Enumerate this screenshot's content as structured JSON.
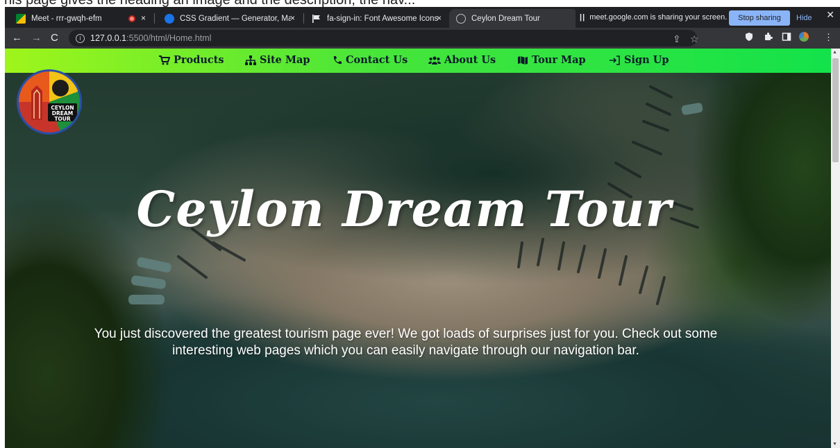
{
  "top_strip_text": "his page gives the heading an image and the description, the nav...",
  "browser": {
    "tabs": [
      {
        "label": "Meet - rrr-gwqh-efm",
        "close": "×"
      },
      {
        "label": "CSS Gradient — Generator, Maker",
        "close": "×"
      },
      {
        "label": "fa-sign-in: Font Awesome Icons",
        "close": "×"
      },
      {
        "label": "Ceylon Dream Tour",
        "close": ""
      }
    ],
    "screen_share": {
      "text": "meet.google.com is sharing your screen.",
      "stop_label": "Stop sharing",
      "hide_label": "Hide"
    },
    "url_host": "127.0.0.1",
    "url_path": ":5500/html/Home.html",
    "window_close": "✕"
  },
  "icons": {
    "products": "cart-icon",
    "site_map": "sitemap-icon",
    "contact": "phone-icon",
    "about": "people-icon",
    "tour_map": "map-icon",
    "sign_up": "sign-in-icon"
  },
  "navbar": {
    "items": [
      {
        "label": "Products"
      },
      {
        "label": "Site Map"
      },
      {
        "label": "Contact Us"
      },
      {
        "label": "About Us"
      },
      {
        "label": "Tour Map"
      },
      {
        "label": "Sign Up"
      }
    ],
    "colors": {
      "gradient_start": "#9ff51b",
      "gradient_end": "#13e24a",
      "text": "#0b1a2a"
    }
  },
  "logo": {
    "line1": "CEYLON",
    "line2": "DREAM",
    "line3": "TOUR"
  },
  "hero": {
    "title": "Ceylon Dream Tour",
    "description": "You just discovered the greatest tourism page ever! We got loads of surprises just for you. Check out some interesting web pages which you can easily navigate through our navigation bar."
  }
}
